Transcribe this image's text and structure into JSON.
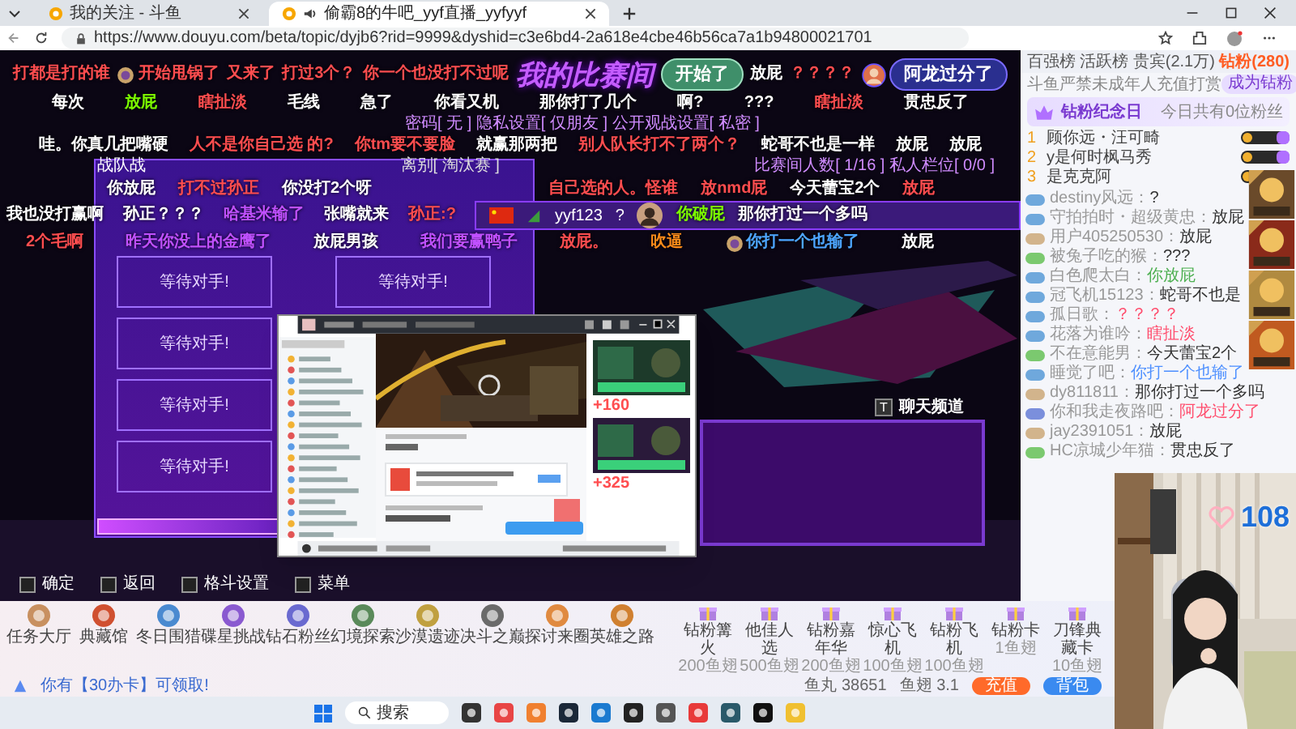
{
  "browser": {
    "tabs": [
      {
        "label": "我的关注 - 斗鱼",
        "selected": false
      },
      {
        "label": "偷霸8的牛吧_yyf直播_yyfyyf",
        "selected": true
      }
    ],
    "url": "https://www.douyu.com/beta/topic/dyjb6?rid=9999&dyshid=c3e6bd4-2a618e4cbe46b56ca7a1b94800021701"
  },
  "stream": {
    "danmaku_rows": [
      [
        {
          "text": "打都是打的谁",
          "kind": "text",
          "color": "#ff4d4f"
        },
        {
          "text": "开始甩锅了",
          "kind": "icon_text",
          "color": "#ff4d4f"
        },
        {
          "text": "又来了",
          "kind": "text",
          "color": "#ff4d4f"
        },
        {
          "text": "打过3个？",
          "kind": "text",
          "color": "#ff4d4f"
        },
        {
          "text": "你一个也没打不过呢",
          "kind": "text",
          "color": "#ff4d4f"
        },
        {
          "text": "我的比赛间",
          "kind": "logo",
          "color": "#c45cff"
        },
        {
          "text": "开始了",
          "kind": "pill",
          "color": "#3f8f6a"
        },
        {
          "text": "放屁",
          "kind": "text",
          "color": "#ffffff"
        },
        {
          "text": "？？？？",
          "kind": "text",
          "color": "#ff4d4f"
        },
        {
          "text": "阿龙过分了",
          "kind": "avatar_pill",
          "color": "#2a2f8f"
        }
      ],
      [
        {
          "text": "每次",
          "kind": "text",
          "color": "#ffffff"
        },
        {
          "text": "放屁",
          "kind": "text",
          "color": "#7cfc00"
        },
        {
          "text": "瞎扯淡",
          "kind": "text",
          "color": "#ff4d4f"
        },
        {
          "text": "毛线",
          "kind": "text",
          "color": "#ffffff"
        },
        {
          "text": "急了",
          "kind": "text",
          "color": "#ffffff"
        },
        {
          "text": "你看又机",
          "kind": "text",
          "color": "#ffffff"
        },
        {
          "text": "那你打了几个",
          "kind": "text",
          "color": "#ffffff"
        },
        {
          "text": "啊?",
          "kind": "text",
          "color": "#ffffff"
        },
        {
          "text": "???",
          "kind": "text",
          "color": "#ffffff"
        },
        {
          "text": "瞎扯淡",
          "kind": "text",
          "color": "#ff4d4f"
        },
        {
          "text": "贯忠反了",
          "kind": "text",
          "color": "#ffffff"
        }
      ],
      [
        {
          "text": "密码[ 无 ] 隐私设置[ 仅朋友 ] 公开观战设置[ 私密 ]",
          "kind": "info",
          "color": "#d08cff"
        }
      ],
      [
        {
          "text": "哇。你真几把嘴硬",
          "kind": "text",
          "color": "#ffffff"
        },
        {
          "text": "人不是你自己选 的?",
          "kind": "text",
          "color": "#ff4d4f"
        },
        {
          "text": "你tm要不要脸",
          "kind": "text",
          "color": "#ff4d4f"
        },
        {
          "text": "就赢那两把",
          "kind": "text",
          "color": "#ffffff"
        },
        {
          "text": "别人队长打不了两个？",
          "kind": "text",
          "color": "#ff4d4f"
        },
        {
          "text": "蛇哥不也是一样",
          "kind": "text",
          "color": "#ffffff"
        },
        {
          "text": "放屁",
          "kind": "text",
          "color": "#ffffff"
        },
        {
          "text": "放屁",
          "kind": "text",
          "color": "#ffffff"
        }
      ],
      [
        {
          "text": "战队战",
          "kind": "info",
          "color": "#ffffff"
        },
        {
          "text": "离别[ 淘汰赛 ]",
          "kind": "info",
          "color": "#dddddd"
        },
        {
          "text": "比赛间人数[ 1/16 ] 私人栏位[ 0/0 ]",
          "kind": "info",
          "color": "#d08cff"
        }
      ],
      [
        {
          "text": "你放屁",
          "kind": "text",
          "color": "#ffffff"
        },
        {
          "text": "打不过孙正",
          "kind": "text",
          "color": "#ff4d4f"
        },
        {
          "text": "你没打2个呀",
          "kind": "text",
          "color": "#ffffff"
        },
        {
          "text": "自己选的人。怪谁",
          "kind": "text",
          "color": "#ff4d4f"
        },
        {
          "text": "放nmd屁",
          "kind": "text",
          "color": "#ff4d4f"
        },
        {
          "text": "今天蕾宝2个",
          "kind": "text",
          "color": "#ffffff"
        },
        {
          "text": "放屁",
          "kind": "text",
          "color": "#ff4d4f"
        }
      ],
      [
        {
          "text": "我也没打赢啊",
          "kind": "text",
          "color": "#ffffff"
        },
        {
          "text": "孙正？？？",
          "kind": "text",
          "color": "#ffffff"
        },
        {
          "text": "哈基米输了",
          "kind": "text",
          "color": "#c050ff"
        },
        {
          "text": "张嘴就来",
          "kind": "text",
          "color": "#ffffff"
        },
        {
          "text": "孙正:?",
          "kind": "text",
          "color": "#ff4d4f"
        },
        {
          "text": "你破屁",
          "kind": "text",
          "color": "#7cfc00"
        },
        {
          "text": "那你打过一个多吗",
          "kind": "text",
          "color": "#ffffff"
        }
      ],
      [
        {
          "text": "2个毛啊",
          "kind": "text",
          "color": "#ff4d4f"
        },
        {
          "text": "昨天你没上的金鹰了",
          "kind": "text",
          "color": "#c050ff"
        },
        {
          "text": "放屁男孩",
          "kind": "text",
          "color": "#ffffff"
        },
        {
          "text": "我们要赢鸭子",
          "kind": "text",
          "color": "#c050ff"
        },
        {
          "text": "放屁。",
          "kind": "text",
          "color": "#ff4d4f"
        },
        {
          "text": "吹逼",
          "kind": "text",
          "color": "#ff8c1a"
        },
        {
          "text": "你打一个也输了",
          "kind": "icon_text",
          "color": "#4da6ff"
        },
        {
          "text": "放屁",
          "kind": "text",
          "color": "#ffffff"
        }
      ]
    ],
    "player_bar": {
      "name": "yyf123",
      "note": "?"
    },
    "slots": [
      "等待对手!",
      "等待对手!",
      "等待对手!",
      "等待对手!",
      "等待对手!"
    ],
    "overlay_window": {
      "prices": [
        "+160",
        "+325"
      ]
    },
    "chat_channel": {
      "key": "T",
      "label": "聊天频道"
    },
    "hints": [
      "确定",
      "返回",
      "格斗设置",
      "菜单"
    ]
  },
  "sidebar": {
    "tabs": [
      {
        "label": "百强榜",
        "selected": false
      },
      {
        "label": "活跃榜",
        "selected": false
      },
      {
        "label": "贵宾(2.1万)",
        "selected": false
      },
      {
        "label": "钻粉(280)",
        "selected": true
      }
    ],
    "notice": "斗鱼严禁未成年人充值打赏",
    "join_button": "成为钻粉",
    "anniversary": {
      "title": "钻粉纪念日",
      "note": "今日共有0位粉丝"
    },
    "ranking": [
      {
        "rank": "1",
        "name": "顾你远・汪可畸"
      },
      {
        "rank": "2",
        "name": "y是何时枫马秀"
      },
      {
        "rank": "3",
        "name": "是克克阿"
      }
    ],
    "chat": [
      {
        "user": "destiny风远：",
        "message": "?",
        "color": "#333333",
        "badge": {
          "color": "#6fa8dc"
        }
      },
      {
        "user": "守拍拍时・超级黄忠：",
        "message": "放屁",
        "color": "#333333",
        "badge": {
          "color": "#6fa8dc"
        }
      },
      {
        "user": "用户405250530：",
        "message": "放屁",
        "color": "#333333",
        "badge": {
          "color": "#d2b48c"
        }
      },
      {
        "user": "被兔子吃的猴：",
        "message": "???",
        "color": "#333333",
        "badge": {
          "color": "#7bc96f"
        }
      },
      {
        "user": "白色爬太白：",
        "message": "你放屁",
        "color": "#4caf50",
        "badge": {
          "color": "#6fa8dc"
        }
      },
      {
        "user": "冠飞机15123：",
        "message": "蛇哥不也是",
        "color": "#333333",
        "badge": {
          "color": "#6fa8dc"
        }
      },
      {
        "user": "孤日歌：",
        "message": "？？？？",
        "color": "#ff4d6d",
        "badge": {
          "color": "#6fa8dc"
        }
      },
      {
        "user": "花落为谁吟：",
        "message": "瞎扯淡",
        "color": "#ff4d6d",
        "badge": {
          "color": "#6fa8dc"
        }
      },
      {
        "user": "不在意能男：",
        "message": "今天蕾宝2个",
        "color": "#333333",
        "badge": {
          "color": "#7bc96f"
        }
      },
      {
        "user": "睡觉了吧：",
        "message": "你打一个也输了",
        "color": "#4d8fff",
        "badge": {
          "color": "#6fa8dc"
        }
      },
      {
        "user": "dy811811：",
        "message": "那你打过一个多吗",
        "color": "#333333",
        "badge": {
          "color": "#d2b48c"
        }
      },
      {
        "user": "你和我走夜路吧：",
        "message": "阿龙过分了",
        "color": "#ff4d6d",
        "badge": {
          "color": "#7b8fdc"
        }
      },
      {
        "user": "jay2391051：",
        "message": "放屁",
        "color": "#333333",
        "badge": {
          "color": "#d2b48c"
        }
      },
      {
        "user": "HC凉城少年猫：",
        "message": "贯忠反了",
        "color": "#333333",
        "badge": {
          "color": "#7bc96f"
        }
      }
    ]
  },
  "webcam": {
    "likes": "108"
  },
  "gift_bar": {
    "activities": [
      "任务大厅",
      "典藏馆",
      "冬日围猎",
      "碟星挑战",
      "钻石粉丝",
      "幻境探索",
      "沙漠遗迹",
      "决斗之巅",
      "探讨来圈",
      "英雄之路"
    ],
    "gifts": [
      {
        "name": "钻粉篝火",
        "price": "200鱼翅"
      },
      {
        "name": "他佳人选",
        "price": "500鱼翅"
      },
      {
        "name": "钻粉嘉年华",
        "price": "200鱼翅"
      },
      {
        "name": "惊心飞机",
        "price": "100鱼翅"
      },
      {
        "name": "钻粉飞机",
        "price": "100鱼翅"
      },
      {
        "name": "钻粉卡",
        "price": "1鱼翅"
      },
      {
        "name": "刀锋典藏卡",
        "price": "10鱼翅"
      }
    ],
    "promo": "你有【30办卡】可领取!",
    "fish_balls": "鱼丸 38651",
    "fins": "鱼翅 3.1",
    "buttons": [
      "充值",
      "背包"
    ]
  },
  "taskbar": {
    "search": "搜索"
  }
}
